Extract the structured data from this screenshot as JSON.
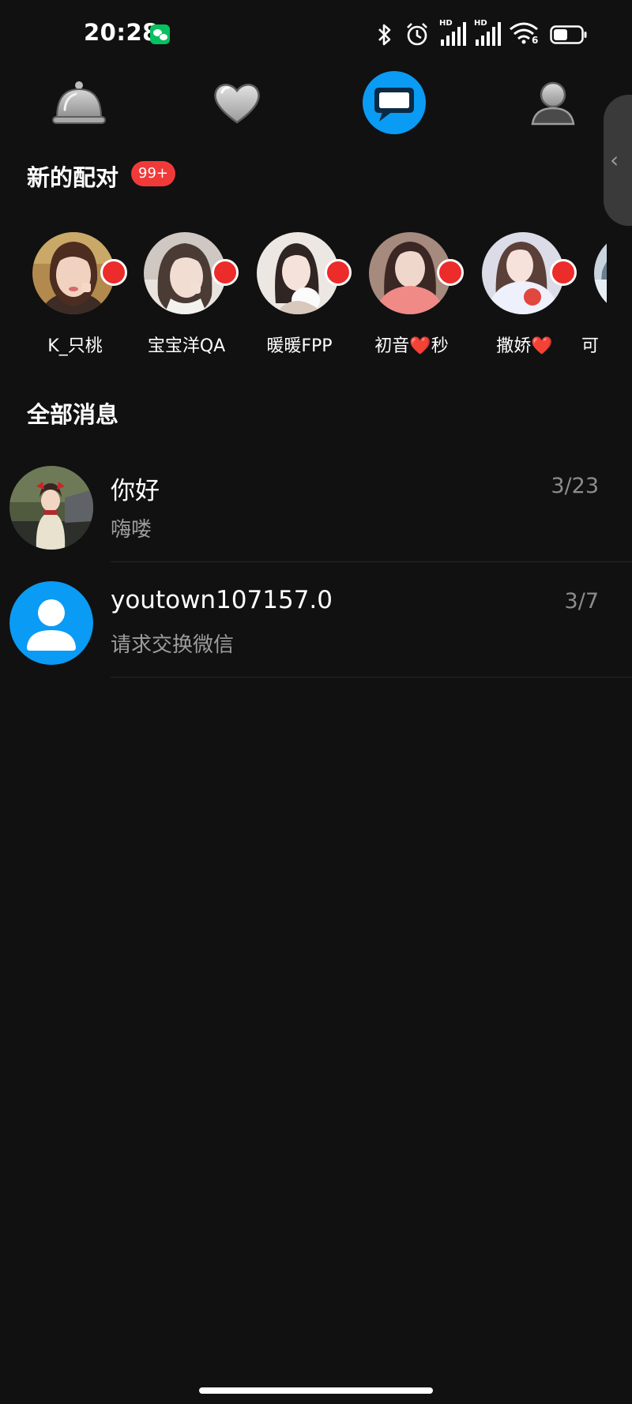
{
  "status_bar": {
    "time": "20:28",
    "icons": [
      "wechat-icon",
      "bluetooth-icon",
      "alarm-icon",
      "signal-hd-icon",
      "signal-hd-icon",
      "wifi-icon",
      "battery-icon"
    ],
    "signal_label_1": "HD",
    "signal_label_2": "HD",
    "wifi_label": "6"
  },
  "nav": {
    "tabs": [
      {
        "icon": "cloche-icon",
        "active": false
      },
      {
        "icon": "heart-icon",
        "active": false
      },
      {
        "icon": "chat-bubble-icon",
        "active": true
      },
      {
        "icon": "profile-icon",
        "active": false
      }
    ],
    "accent_color": "#0a9bf4"
  },
  "matches": {
    "title": "新的配对",
    "badge": "99+",
    "items": [
      {
        "name": "K_只桃",
        "online": true
      },
      {
        "name": "宝宝洋QA",
        "online": true
      },
      {
        "name": "暖暖FPP",
        "online": true
      },
      {
        "name": "初音❤️秒",
        "online": true
      },
      {
        "name": "撒娇❤️",
        "online": true
      },
      {
        "name": "可",
        "online": false
      }
    ]
  },
  "messages": {
    "title": "全部消息",
    "items": [
      {
        "name": "你好",
        "preview": "嗨喽",
        "date": "3/23"
      },
      {
        "name": "youtown107157.0",
        "preview": "请求交换微信",
        "date": "3/7"
      }
    ]
  },
  "edge_handle": {
    "icon": "chevron-left-icon",
    "glyph": "‹"
  }
}
